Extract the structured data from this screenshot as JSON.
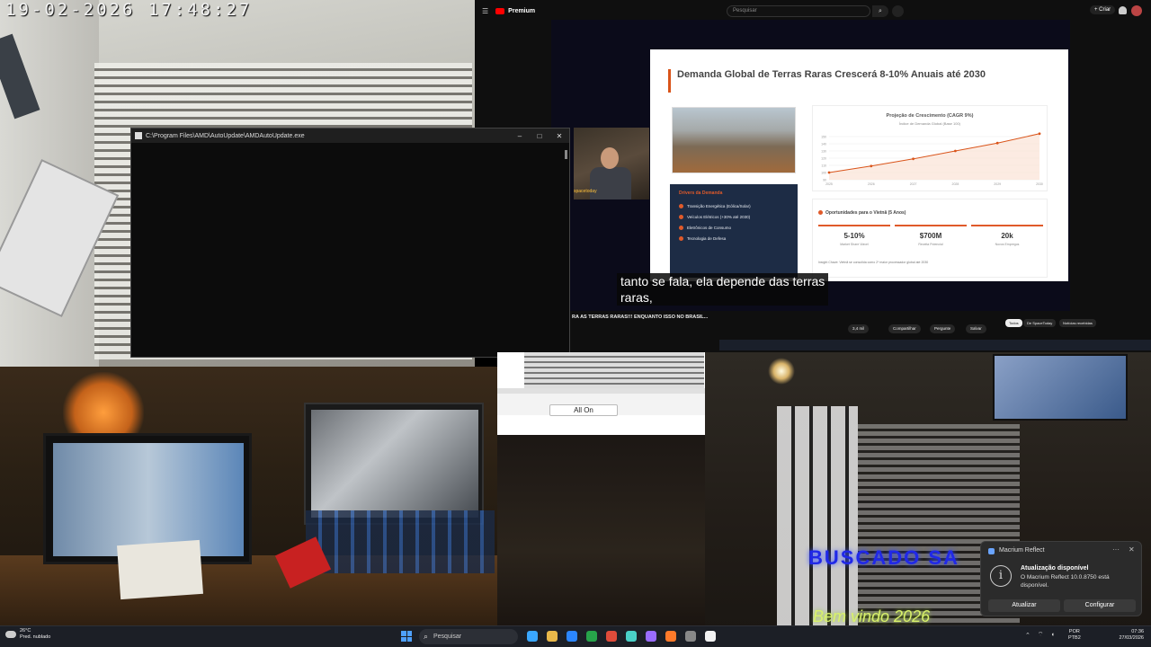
{
  "camera_top_left": {
    "timestamp": "19-02-2026 17:48:27"
  },
  "console_window": {
    "title": "C:\\Program Files\\AMD\\AutoUpdate\\AMDAutoUpdate.exe",
    "minimize": "–",
    "maximize": "□",
    "close": "✕"
  },
  "youtube": {
    "logo": "Premium",
    "search_placeholder": "Pesquisar",
    "create_label": "+ Criar",
    "video_title": "RA AS TERRAS RARAS!!! ENQUANTO ISSO NO BRASIL...",
    "subtitle": "tanto se fala, ela depende das terras\nraras,",
    "actions": [
      "3,4 mil",
      "Compartilhar",
      "Pergunte",
      "Salvar"
    ],
    "chips": [
      {
        "label": "Todos",
        "active": true
      },
      {
        "label": "De SpaceToday",
        "active": false
      },
      {
        "label": "Notícias recebidas",
        "active": false
      }
    ],
    "webcam_tag": "spacetoday",
    "slide": {
      "title": "Demanda Global de Terras Raras Crescerá 8-10% Anuais até 2030",
      "chart_title": "Projeção de Crescimento (CAGR 9%)",
      "chart_legend": "Índice de Demanda Global (Base 100)",
      "drivers_title": "Drivers da Demanda",
      "drivers": [
        "Transição Energética (Eólica/Solar)",
        "Veículos Elétricos (+30% até 2030)",
        "Eletrônicos de Consumo",
        "Tecnologia de Defesa"
      ],
      "opportunities_title": "Oportunidades para o Vietnã (5 Anos)",
      "kpis": [
        {
          "value": "5-10%",
          "label": "Market Share Viável"
        },
        {
          "value": "$700M",
          "label": "Receita Potencial"
        },
        {
          "value": "20k",
          "label": "Novos Empregos"
        }
      ],
      "footnote": "Insight Chave: Vietnã se consolida como 2º maior processador global até 2030"
    }
  },
  "chart_data": {
    "type": "line",
    "title": "Projeção de Crescimento (CAGR 9%)",
    "x": [
      2025,
      2026,
      2027,
      2028,
      2029,
      2030
    ],
    "series": [
      {
        "name": "Índice de Demanda Global (Base 100)",
        "values": [
          100,
          109,
          119,
          130,
          141,
          154
        ]
      }
    ],
    "ylim": [
      90,
      160
    ],
    "yticks": [
      90,
      100,
      110,
      120,
      130,
      140,
      150
    ],
    "line_color": "#d9541a"
  },
  "middle_window": {
    "button_label": "All On"
  },
  "camera_bottom_right": {
    "neon_text": "BUSCADO SA",
    "welcome_text": "Bem vindo 2026"
  },
  "notification": {
    "app": "Macrium Reflect",
    "heading": "Atualização disponível",
    "body": "O Macrium Reflect 10.0.8750 está disponível.",
    "action_primary": "Atualizar",
    "action_secondary": "Configurar",
    "more": "···",
    "close": "✕",
    "info_icon": "i"
  },
  "taskbar": {
    "weather_temp": "26°C",
    "weather_desc": "Pred. nublado",
    "search_placeholder": "Pesquisar",
    "language": "POR",
    "keyboard": "PTB2",
    "time": "07:36",
    "date": "27/03/2026",
    "icon_colors": [
      "#3aa7ff",
      "#e8b84a",
      "#2b86ff",
      "#27a34a",
      "#e04b3a",
      "#4ad0c8",
      "#9a6cff",
      "#ff7a2a",
      "#888888",
      "#f2f2f2"
    ]
  }
}
